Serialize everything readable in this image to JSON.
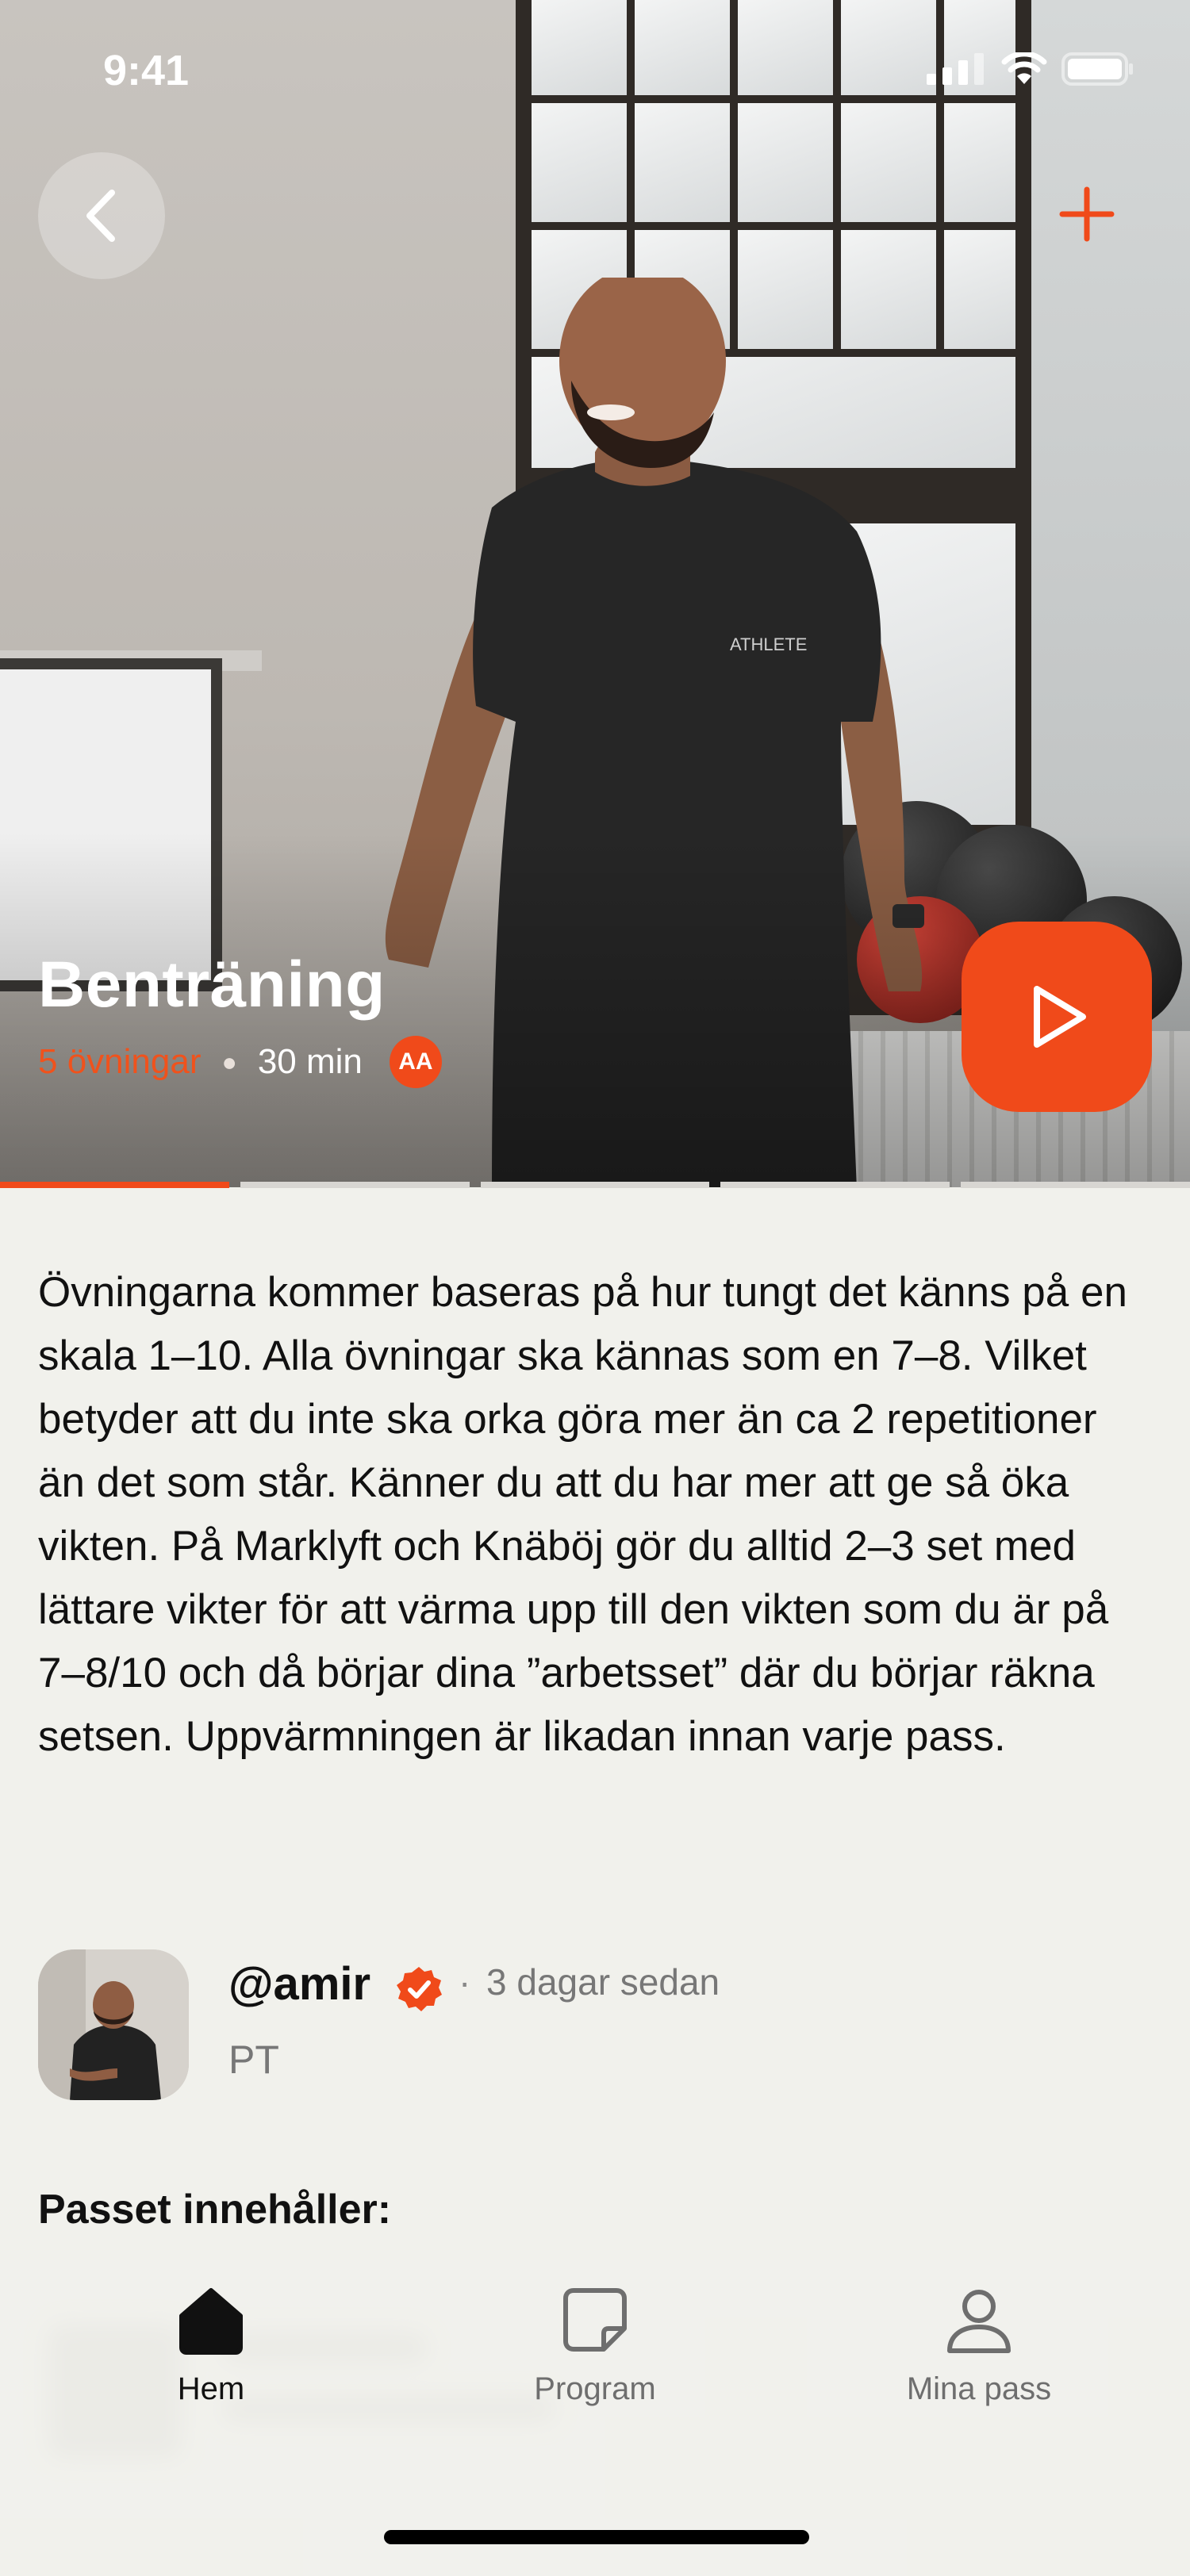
{
  "status_bar": {
    "time": "9:41"
  },
  "header": {
    "back_icon": "chevron-left-icon",
    "add_icon": "plus-icon"
  },
  "workout": {
    "title": "Benträning",
    "exercise_count": "5 övningar",
    "duration": "30 min",
    "author_badge": "AA",
    "progress_segments": 5,
    "active_segment": 1,
    "description": "Övningarna kommer baseras på hur tungt det känns på en skala 1–10. Alla övningar ska kännas som en 7–8. Vilket betyder att du inte ska orka göra mer än ca 2 repetitioner än det som står. Känner du att du har mer att ge så öka vikten. På Marklyft och Knäböj gör du alltid 2–3 set med lättare vikter för att värma upp till den  vikten som du är på 7–8/10 och då börjar dina ”arbetsset” där du börjar räkna setsen. Uppvärmningen är  likadan innan varje pass."
  },
  "author": {
    "handle": "@amir",
    "separator": "·",
    "posted": "3 dagar sedan",
    "role": "PT"
  },
  "section_title": "Passet innehåller:",
  "tabbar": {
    "items": [
      {
        "label": "Hem",
        "icon": "home-icon",
        "active": true
      },
      {
        "label": "Program",
        "icon": "note-icon",
        "active": false
      },
      {
        "label": "Mina pass",
        "icon": "person-icon",
        "active": false
      }
    ]
  },
  "colors": {
    "accent": "#f04a1a",
    "background": "#f1f1ec",
    "text": "#111111",
    "muted": "#777777"
  }
}
